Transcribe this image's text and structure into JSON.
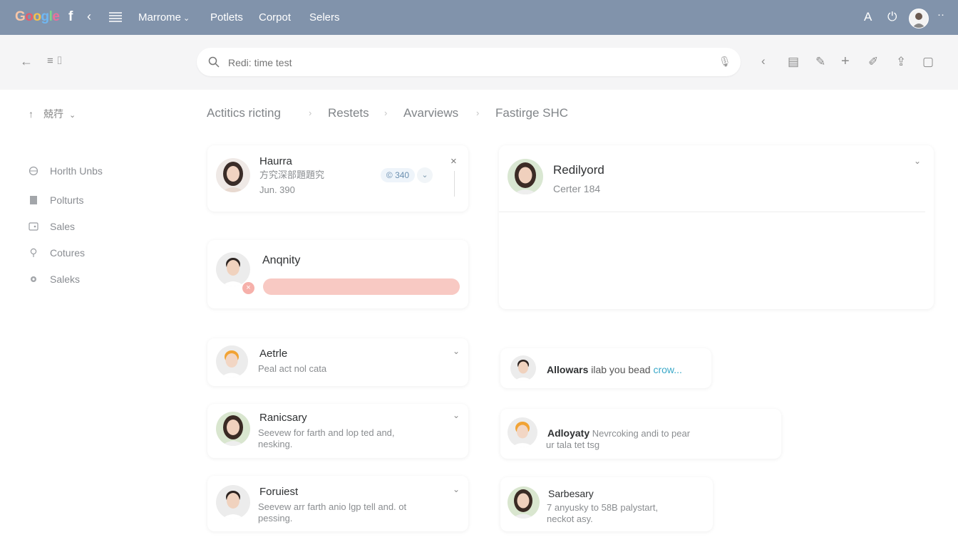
{
  "topbar": {
    "brand_letters": [
      "G",
      "o",
      "o",
      "g",
      "l",
      "e"
    ],
    "brand_text": "Google",
    "nav": [
      "Marrome",
      "Potlets",
      "Corpot",
      "Selers"
    ],
    "icons": [
      "facebook-icon",
      "back-icon",
      "list-icon",
      "text-size-icon",
      "power-icon",
      "avatar",
      "more-icon"
    ]
  },
  "toolbar": {
    "search_placeholder": "Redi: time test",
    "icons": [
      "back-arrow-icon",
      "filter-icon",
      "mic-icon",
      "prev-icon",
      "archive-icon",
      "edit-icon",
      "add-icon",
      "pen-icon",
      "share-icon",
      "copy-icon"
    ]
  },
  "breadcrumbs": [
    "Actitics ricting",
    "Restets",
    "Avarviews",
    "Fastirge SHC"
  ],
  "sidebar": {
    "header": "兢荇",
    "items": [
      {
        "label": "Horlth Unbs",
        "icon": "globe-icon"
      },
      {
        "label": "Polturts",
        "icon": "document-icon"
      },
      {
        "label": "Sales",
        "icon": "wallet-icon"
      },
      {
        "label": "Cotures",
        "icon": "pin-icon"
      },
      {
        "label": "Saleks",
        "icon": "gear-icon"
      }
    ]
  },
  "cards": {
    "haurra": {
      "name": "Haurra",
      "line1": "方究深部題題究",
      "line2": "Jun. 390",
      "badge": "© 340"
    },
    "redilyord": {
      "name": "Redilyord",
      "sub": "Certer 184"
    },
    "anqnity": {
      "name": "Anqnity",
      "progress_percent": 100
    },
    "aetrle": {
      "name": "Aetrle",
      "sub": "Peal act nol cata"
    },
    "ranicsary": {
      "name": "Ranicsary",
      "sub1": "Seevew for farth and lop ted and,",
      "sub2": "nesking."
    },
    "foruiest": {
      "name": "Foruiest",
      "sub1": "Seevew arr farth anio lgp tell and. ot",
      "sub2": "pessing."
    },
    "allowars": {
      "name": "Allowars",
      "text": "ilab you bead",
      "link": "crow..."
    },
    "adloyaty": {
      "name": "Adloyaty",
      "text": "Nevrcoking andi to pear",
      "sub2": "ur tala tet tsg"
    },
    "sarbesary": {
      "name": "Sarbesary",
      "sub1": "7 anyusky to 58B palystart,",
      "sub2": "neckot asy."
    }
  },
  "colors": {
    "topbar": "#8193ab",
    "toolbar": "#f5f5f6",
    "progress": "#f8c9c3",
    "accent": "#3aa8c8"
  }
}
